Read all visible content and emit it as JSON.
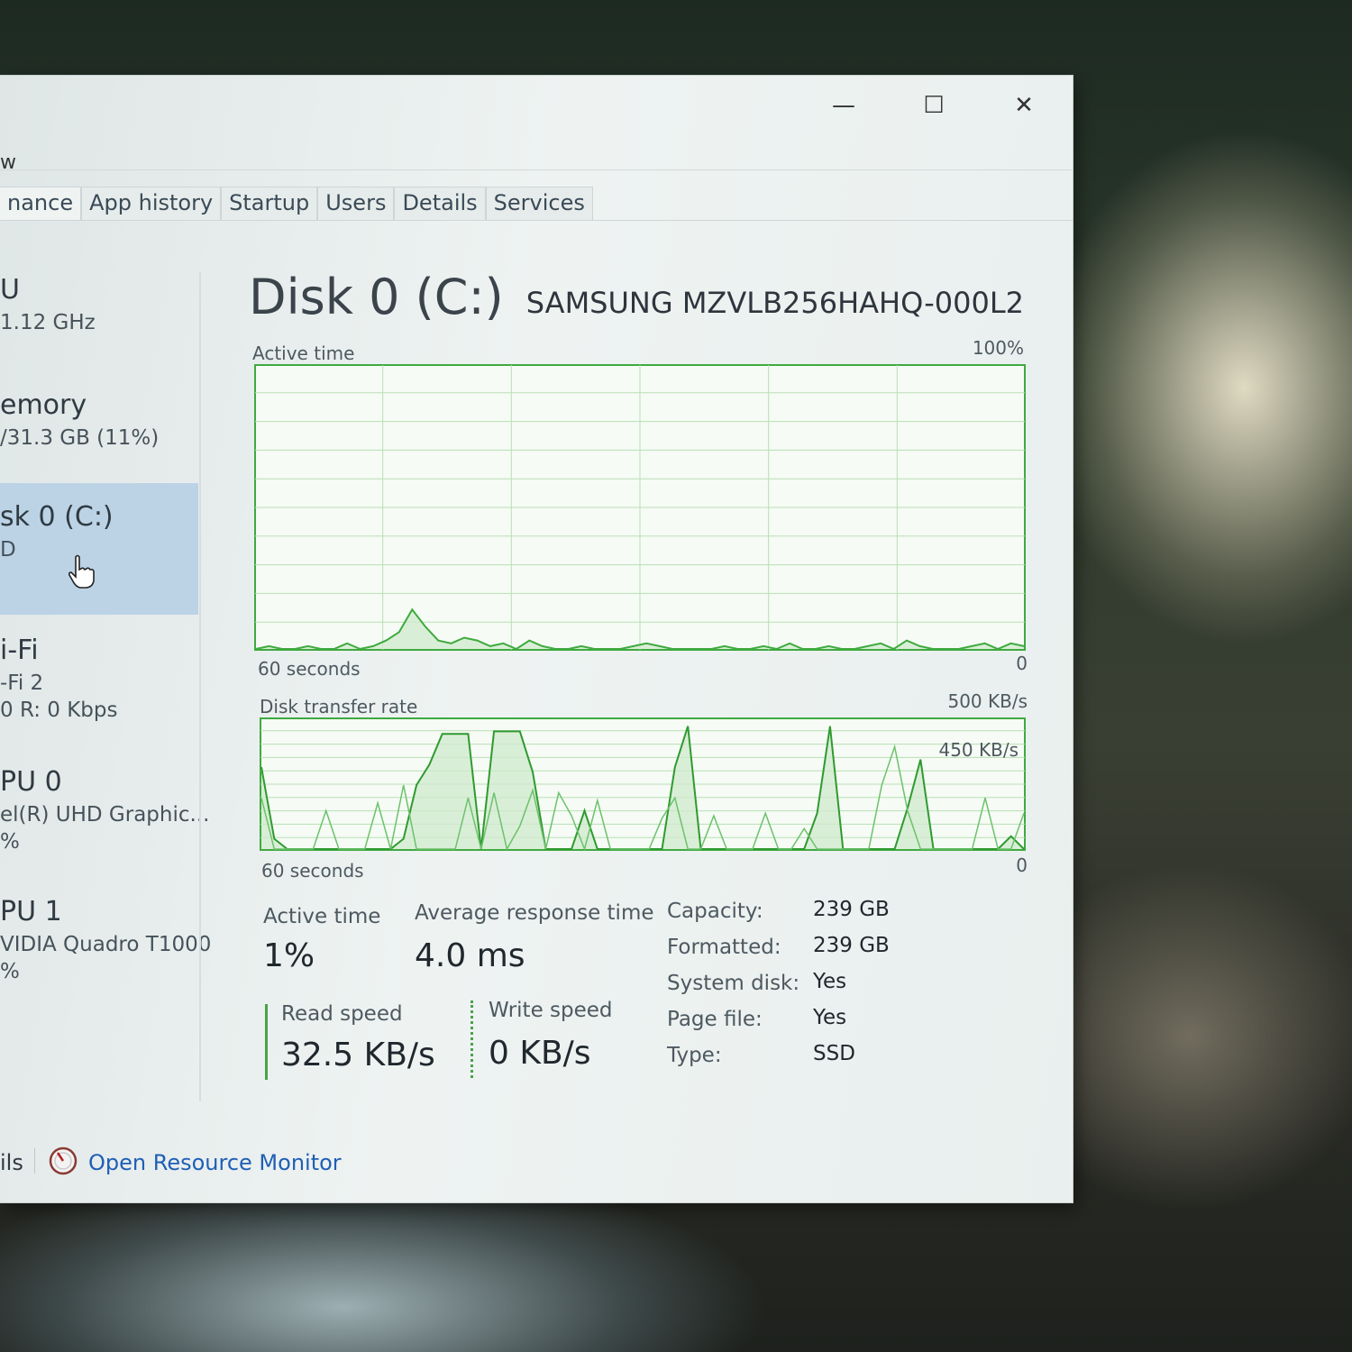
{
  "window": {
    "controls": {
      "minimize": "—",
      "maximize": "☐",
      "close": "✕"
    },
    "menu_fragment": "w"
  },
  "tabs": [
    {
      "label": "nance",
      "active": true
    },
    {
      "label": "App history",
      "active": false
    },
    {
      "label": "Startup",
      "active": false
    },
    {
      "label": "Users",
      "active": false
    },
    {
      "label": "Details",
      "active": false
    },
    {
      "label": "Services",
      "active": false
    }
  ],
  "sidebar": {
    "items": [
      {
        "title": "U",
        "line2": "1.12 GHz",
        "line3": ""
      },
      {
        "title": "emory",
        "line2": "/31.3 GB (11%)",
        "line3": ""
      },
      {
        "title": "sk 0 (C:)",
        "line2": "D",
        "line3": "",
        "selected": true
      },
      {
        "title": "i-Fi",
        "line2": "-Fi 2",
        "line3": "0 R: 0 Kbps"
      },
      {
        "title": "PU 0",
        "line2": "el(R) UHD Graphic...",
        "line3": "%"
      },
      {
        "title": "PU 1",
        "line2": "VIDIA Quadro T1000",
        "line3": "%"
      }
    ]
  },
  "main": {
    "title": "Disk 0 (C:)",
    "model": "SAMSUNG MZVLB256HAHQ-000L2",
    "active_graph": {
      "label": "Active time",
      "max_label": "100%",
      "time_label": "60 seconds",
      "min_label": "0",
      "values": [
        0,
        1,
        0,
        0,
        1,
        0,
        0,
        2,
        0,
        1,
        3,
        6,
        14,
        8,
        3,
        2,
        4,
        3,
        1,
        2,
        0,
        3,
        1,
        0,
        0,
        1,
        0,
        0,
        0,
        1,
        2,
        1,
        0,
        0,
        0,
        0,
        1,
        0,
        0,
        1,
        0,
        2,
        0,
        0,
        1,
        0,
        0,
        1,
        2,
        0,
        3,
        1,
        0,
        0,
        0,
        1,
        2,
        0,
        2,
        1
      ]
    },
    "transfer_graph": {
      "label": "Disk transfer rate",
      "max_label": "500 KB/s",
      "inner_label": "450 KB/s",
      "time_label": "60 seconds",
      "min_label": "0",
      "read": [
        320,
        40,
        0,
        0,
        0,
        0,
        0,
        0,
        0,
        0,
        0,
        40,
        250,
        330,
        450,
        450,
        450,
        0,
        460,
        460,
        460,
        300,
        0,
        0,
        0,
        150,
        0,
        0,
        0,
        0,
        0,
        0,
        320,
        480,
        0,
        0,
        0,
        0,
        0,
        0,
        0,
        0,
        0,
        140,
        480,
        0,
        0,
        0,
        0,
        0,
        160,
        350,
        0,
        0,
        0,
        0,
        0,
        0,
        50,
        0
      ],
      "write": [
        200,
        0,
        0,
        0,
        0,
        150,
        0,
        0,
        0,
        180,
        0,
        250,
        0,
        0,
        0,
        0,
        200,
        0,
        220,
        0,
        90,
        230,
        0,
        220,
        130,
        0,
        190,
        0,
        0,
        0,
        0,
        120,
        200,
        0,
        0,
        130,
        0,
        0,
        0,
        140,
        0,
        0,
        80,
        0,
        0,
        0,
        0,
        0,
        250,
        400,
        150,
        0,
        0,
        0,
        0,
        0,
        200,
        0,
        0,
        140
      ]
    },
    "stats": {
      "active_time_label": "Active time",
      "active_time_value": "1%",
      "avg_response_label": "Average response time",
      "avg_response_value": "4.0 ms",
      "read_label": "Read speed",
      "read_value": "32.5 KB/s",
      "write_label": "Write speed",
      "write_value": "0 KB/s"
    },
    "properties": [
      {
        "key": "Capacity:",
        "value": "239 GB"
      },
      {
        "key": "Formatted:",
        "value": "239 GB"
      },
      {
        "key": "System disk:",
        "value": "Yes"
      },
      {
        "key": "Page file:",
        "value": "Yes"
      },
      {
        "key": "Type:",
        "value": "SSD"
      }
    ]
  },
  "footer": {
    "fragment": "ils",
    "resource_monitor": "Open Resource Monitor"
  },
  "colors": {
    "graph_line": "#3faa3f",
    "graph_fill": "#cfe9cc",
    "grid": "#b9dfb5",
    "link": "#1f5fb5"
  }
}
